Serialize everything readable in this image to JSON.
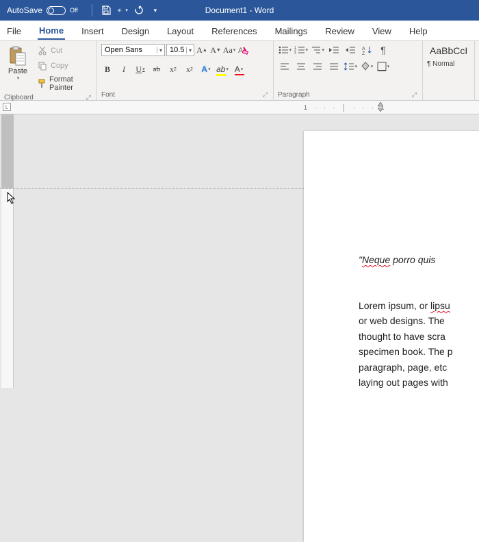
{
  "titlebar": {
    "autosave_label": "AutoSave",
    "autosave_state": "Off",
    "document_title": "Document1 - Word"
  },
  "tabs": [
    "File",
    "Home",
    "Insert",
    "Design",
    "Layout",
    "References",
    "Mailings",
    "Review",
    "View",
    "Help"
  ],
  "active_tab": "Home",
  "ribbon": {
    "clipboard": {
      "label": "Clipboard",
      "paste": "Paste",
      "cut": "Cut",
      "copy": "Copy",
      "format_painter": "Format Painter"
    },
    "font": {
      "label": "Font",
      "font_name": "Open Sans",
      "font_size": "10.5"
    },
    "paragraph": {
      "label": "Paragraph"
    },
    "styles": {
      "sample": "AaBbCcI",
      "name": "Normal"
    }
  },
  "ruler": {
    "numbers": "1 · · · │ · · · 1"
  },
  "document": {
    "quote_prefix": "\"",
    "quote_word": "Neque",
    "quote_rest": " porro quis",
    "body_pre": "Lorem ipsum, or ",
    "body_lipsu": "lipsu",
    "body_rest": " or web designs. The thought to have scra specimen book. The p paragraph, page, etc laying out pages with"
  }
}
